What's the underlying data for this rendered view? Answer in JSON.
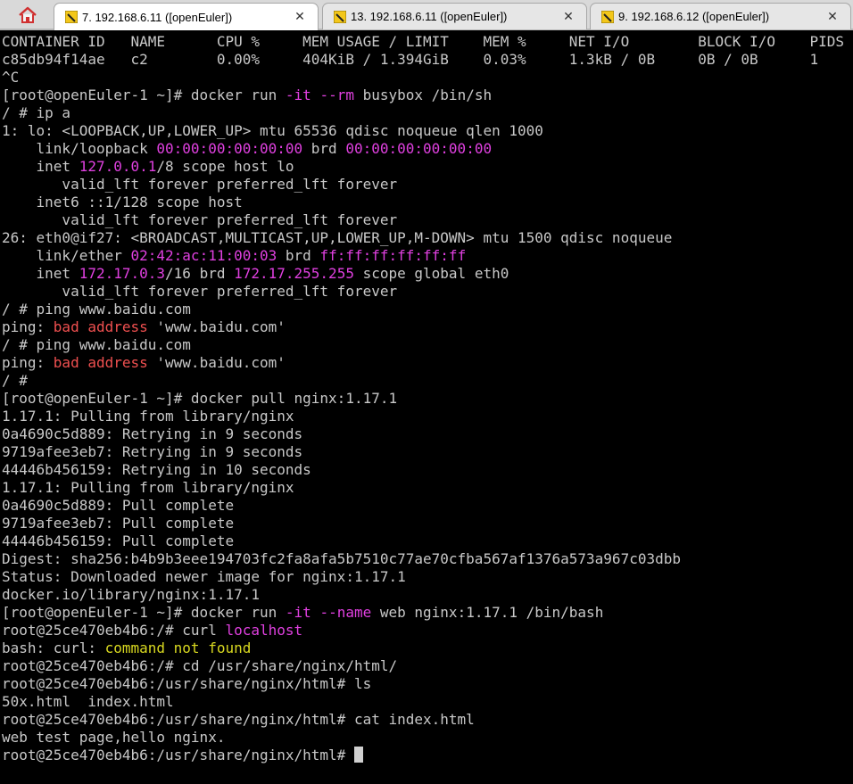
{
  "tabs": [
    {
      "label": "7. 192.168.6.11 ([openEuler])",
      "active": true
    },
    {
      "label": "13. 192.168.6.11 ([openEuler])",
      "active": false
    },
    {
      "label": "9. 192.168.6.12 ([openEuler])",
      "active": false
    }
  ],
  "terminal": {
    "lines": [
      [
        {
          "t": "CONTAINER ID   NAME      CPU %     MEM USAGE / LIMIT    MEM %     NET I/O        BLOCK I/O    PIDS"
        }
      ],
      [
        {
          "t": "c85db94f14ae   c2        0.00%     404KiB / 1.394GiB    0.03%     1.3kB / 0B     0B / 0B      1"
        }
      ],
      [
        {
          "t": "^C"
        }
      ],
      [
        {
          "t": "[root@openEuler-1 ~]# docker run "
        },
        {
          "t": "-it",
          "c": "mag"
        },
        {
          "t": " "
        },
        {
          "t": "--rm",
          "c": "mag"
        },
        {
          "t": " busybox /bin/sh"
        }
      ],
      [
        {
          "t": "/ # ip a"
        }
      ],
      [
        {
          "t": "1: lo: <LOOPBACK,UP,LOWER_UP> mtu 65536 qdisc noqueue qlen 1000"
        }
      ],
      [
        {
          "t": "    link/loopback "
        },
        {
          "t": "00:00:00:00:00:00",
          "c": "mag"
        },
        {
          "t": " brd "
        },
        {
          "t": "00:00:00:00:00:00",
          "c": "mag"
        }
      ],
      [
        {
          "t": "    inet "
        },
        {
          "t": "127.0.0.1",
          "c": "mag"
        },
        {
          "t": "/8 scope host lo"
        }
      ],
      [
        {
          "t": "       valid_lft forever preferred_lft forever"
        }
      ],
      [
        {
          "t": "    inet6 ::1/128 scope host"
        }
      ],
      [
        {
          "t": "       valid_lft forever preferred_lft forever"
        }
      ],
      [
        {
          "t": "26: eth0@if27: <BROADCAST,MULTICAST,UP,LOWER_UP,M-DOWN> mtu 1500 qdisc noqueue"
        }
      ],
      [
        {
          "t": "    link/ether "
        },
        {
          "t": "02:42:ac:11:00:03",
          "c": "mag"
        },
        {
          "t": " brd "
        },
        {
          "t": "ff:ff:ff:ff:ff:ff",
          "c": "mag"
        }
      ],
      [
        {
          "t": "    inet "
        },
        {
          "t": "172.17.0.3",
          "c": "mag"
        },
        {
          "t": "/16 brd "
        },
        {
          "t": "172.17.255.255",
          "c": "mag"
        },
        {
          "t": " scope global eth0"
        }
      ],
      [
        {
          "t": "       valid_lft forever preferred_lft forever"
        }
      ],
      [
        {
          "t": "/ # ping www.baidu.com"
        }
      ],
      [
        {
          "t": "ping: "
        },
        {
          "t": "bad address",
          "c": "red"
        },
        {
          "t": " 'www.baidu.com'"
        }
      ],
      [
        {
          "t": "/ # ping www.baidu.com"
        }
      ],
      [
        {
          "t": "ping: "
        },
        {
          "t": "bad address",
          "c": "red"
        },
        {
          "t": " 'www.baidu.com'"
        }
      ],
      [
        {
          "t": "/ #"
        }
      ],
      [
        {
          "t": "[root@openEuler-1 ~]# docker pull nginx:1.17.1"
        }
      ],
      [
        {
          "t": "1.17.1: Pulling from library/nginx"
        }
      ],
      [
        {
          "t": "0a4690c5d889: Retrying in 9 seconds"
        }
      ],
      [
        {
          "t": "9719afee3eb7: Retrying in 9 seconds"
        }
      ],
      [
        {
          "t": "44446b456159: Retrying in 10 seconds"
        }
      ],
      [
        {
          "t": "1.17.1: Pulling from library/nginx"
        }
      ],
      [
        {
          "t": "0a4690c5d889: Pull complete"
        }
      ],
      [
        {
          "t": "9719afee3eb7: Pull complete"
        }
      ],
      [
        {
          "t": "44446b456159: Pull complete"
        }
      ],
      [
        {
          "t": "Digest: sha256:b4b9b3eee194703fc2fa8afa5b7510c77ae70cfba567af1376a573a967c03dbb"
        }
      ],
      [
        {
          "t": "Status: Downloaded newer image for nginx:1.17.1"
        }
      ],
      [
        {
          "t": "docker.io/library/nginx:1.17.1"
        }
      ],
      [
        {
          "t": "[root@openEuler-1 ~]# docker run "
        },
        {
          "t": "-it",
          "c": "mag"
        },
        {
          "t": " "
        },
        {
          "t": "--name",
          "c": "mag"
        },
        {
          "t": " web nginx:1.17.1 /bin/bash"
        }
      ],
      [
        {
          "t": "root@25ce470eb4b6:/# curl "
        },
        {
          "t": "localhost",
          "c": "mag"
        }
      ],
      [
        {
          "t": "bash: curl: "
        },
        {
          "t": "command not found",
          "c": "yel"
        }
      ],
      [
        {
          "t": "root@25ce470eb4b6:/# cd /usr/share/nginx/html/"
        }
      ],
      [
        {
          "t": "root@25ce470eb4b6:/usr/share/nginx/html# ls"
        }
      ],
      [
        {
          "t": "50x.html  index.html"
        }
      ],
      [
        {
          "t": "root@25ce470eb4b6:/usr/share/nginx/html# cat index.html"
        }
      ],
      [
        {
          "t": "web test page,hello nginx."
        }
      ],
      [
        {
          "t": "root@25ce470eb4b6:/usr/share/nginx/html# "
        }
      ]
    ]
  }
}
